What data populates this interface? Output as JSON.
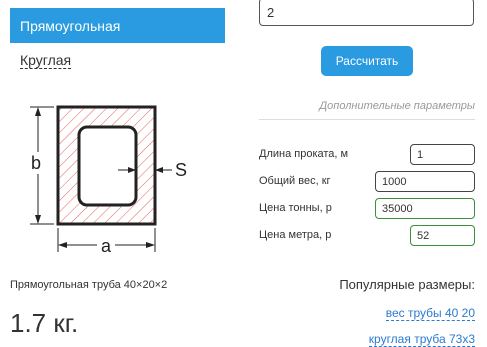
{
  "tabs": {
    "active_label": "Прямоугольная",
    "inactive_label": "Круглая"
  },
  "top_input": {
    "value": "2"
  },
  "calculate_label": "Рассчитать",
  "extra_params": {
    "title": "Дополнительные параметры",
    "length": {
      "label": "Длина проката, м",
      "value": "1"
    },
    "total_weight": {
      "label": "Общий вес, кг",
      "value": "1000"
    },
    "ton_price": {
      "label": "Цена тонны, р",
      "value": "35000"
    },
    "meter_price": {
      "label": "Цена метра, р",
      "value": "52"
    }
  },
  "diagram": {
    "label_b": "b",
    "label_a": "a",
    "label_s": "S"
  },
  "result": {
    "pipe_name": "Прямоугольная труба 40×20×2",
    "weight": "1.7 кг."
  },
  "popular": {
    "title": "Популярные размеры:",
    "links": [
      "вес трубы 40 20",
      "круглая труба 73х3"
    ]
  },
  "colors": {
    "accent": "#2a9be0",
    "hatch": "#e86060",
    "valid_border": "#3a8f3a"
  }
}
